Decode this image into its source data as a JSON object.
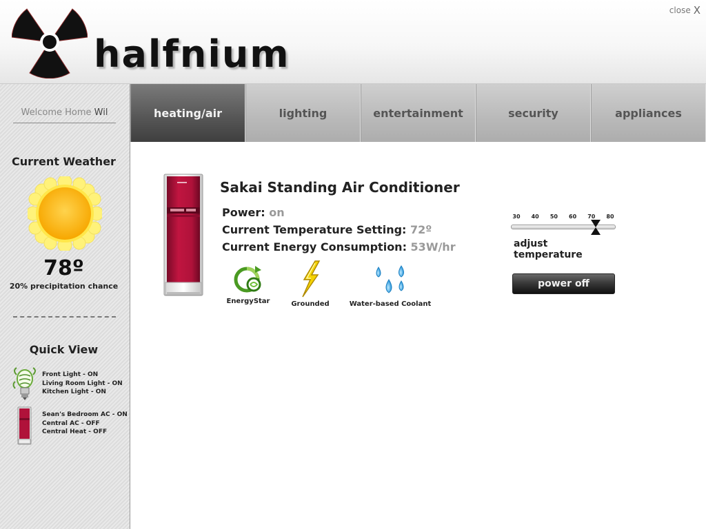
{
  "app": {
    "brand": "halfnium",
    "close_label": "close",
    "close_glyph": "X"
  },
  "sidebar": {
    "welcome_prefix": "Welcome Home ",
    "welcome_name": "Wil",
    "weather_title": "Current Weather",
    "weather_icon": "sun-icon",
    "temperature": "78º",
    "precipitation": "20% precipitation chance",
    "quick_view_title": "Quick View",
    "quick_view": [
      {
        "icon": "light-bulb-icon",
        "lines": [
          "Front Light - ON",
          "Living Room Light - ON",
          "Kitchen Light - ON"
        ]
      },
      {
        "icon": "air-conditioner-icon",
        "lines": [
          "Sean's Bedroom AC - ON",
          "Central AC - OFF",
          "Central Heat - OFF"
        ]
      }
    ]
  },
  "nav": {
    "tabs": [
      {
        "label": "heating/air",
        "active": true
      },
      {
        "label": "lighting",
        "active": false
      },
      {
        "label": "entertainment",
        "active": false
      },
      {
        "label": "security",
        "active": false
      },
      {
        "label": "appliances",
        "active": false
      }
    ]
  },
  "device": {
    "title": "Sakai Standing Air Conditioner",
    "power_label": "Power:",
    "power_value": "on",
    "temp_label": "Current Temperature Setting:",
    "temp_value": "72º",
    "energy_label": "Current Energy Consumption:",
    "energy_value": "53W/hr",
    "features": [
      {
        "icon": "energystar-icon",
        "label": "EnergyStar"
      },
      {
        "icon": "lightning-bolt-icon",
        "label": "Grounded"
      },
      {
        "icon": "water-drops-icon",
        "label": "Water-based Coolant"
      }
    ],
    "slider": {
      "ticks": [
        "30",
        "40",
        "50",
        "60",
        "70",
        "80"
      ],
      "min": 30,
      "max": 80,
      "value": 72,
      "label": "adjust temperature"
    },
    "power_button": "power off"
  },
  "colors": {
    "ac_body": "#b0123a",
    "accent_gray": "#555555",
    "muted_value": "#999999"
  }
}
